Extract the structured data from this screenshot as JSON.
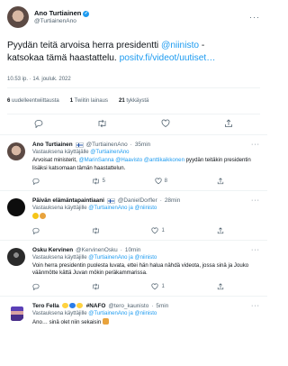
{
  "main_tweet": {
    "author_name": "Ano Turtiainen",
    "author_handle": "@TurtiainenAno",
    "text_line1": "Pyydän teitä arvoisa herra presidentti ",
    "mention": "@niinisto",
    "text_line1_end": " -",
    "text_line2": "katsokaa tämä haastattelu. ",
    "link": "positv.fi/videot/uutiset…",
    "timestamp": "10.53 ip. · 14. jouluk. 2022",
    "stats": {
      "retweets_count": "6",
      "retweets_label": "uudelleentwiittausta",
      "quotes_count": "1",
      "quotes_label": "Twiitin lainaus",
      "likes_count": "21",
      "likes_label": "tykkäystä"
    }
  },
  "replies": [
    {
      "name": "Ano Turtiainen",
      "handle": "@TurtiainenAno",
      "time": "35min",
      "replying_to_label": "Vastauksena käyttäjälle ",
      "replying_to": "@TurtiainenAno",
      "text_prefix": "Arvoisat ministerit, ",
      "text_mentions": "@MarinSanna @Haavisto @anttikaikkonen",
      "text_suffix": " pyydän teitäkin presidentin lisäksi katsomaan tämän haastattelun.",
      "reply_count": "",
      "retweet_count": "5",
      "like_count": "8"
    },
    {
      "name": "Päivän elämäntapaintiaani",
      "handle": "@DanielDorfler",
      "time": "28min",
      "replying_to_label": "Vastauksena käyttäjille ",
      "replying_to": "@TurtiainenAno ja @niinisto",
      "text": "",
      "emojis": [
        "#f5c518",
        "#e8a33d"
      ],
      "reply_count": "",
      "retweet_count": "",
      "like_count": "1"
    },
    {
      "name": "Osku Kervinen",
      "handle": "@KervinenOsku",
      "time": "10min",
      "replying_to_label": "Vastauksena käyttäjille ",
      "replying_to": "@TurtiainenAno ja @niinisto",
      "text": "Voin herra presidentin puolesta luvata, ettei hän halua nähdä videota, jossa sinä ja Jouko väänmötte kättä Juvan mökin peräkammarissa.",
      "reply_count": "",
      "retweet_count": "",
      "like_count": "1"
    },
    {
      "name": "Tero Fella",
      "handle": "@tero_kaunisto",
      "time": "5min",
      "name_tags": "#NAFO",
      "replying_to_label": "Vastauksena käyttäjille ",
      "replying_to": "@TurtiainenAno ja @niinisto",
      "text": "Ano… sinä olet niin sekaisin",
      "reply_count": "",
      "retweet_count": "",
      "like_count": ""
    }
  ],
  "colors": {
    "accent": "#1d9bf0",
    "text": "#0f1419",
    "muted": "#536471",
    "divider": "#eff3f4",
    "like_red": "#f91880"
  },
  "icons": [
    "verified-badge-icon",
    "finland-flag-icon",
    "more-icon",
    "reply-icon",
    "retweet-icon",
    "like-icon",
    "share-icon"
  ]
}
